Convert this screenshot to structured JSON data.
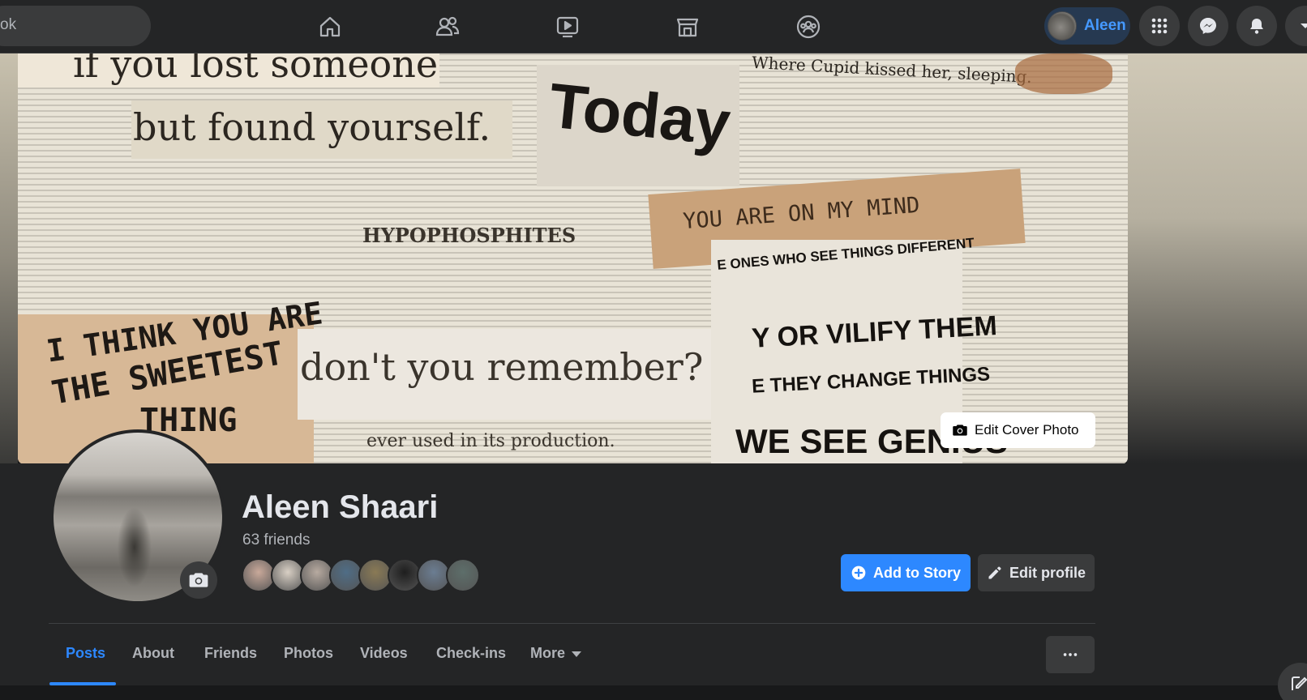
{
  "search": {
    "value": "ok"
  },
  "nav": [
    {
      "name": "home-icon"
    },
    {
      "name": "friends-icon"
    },
    {
      "name": "watch-icon"
    },
    {
      "name": "marketplace-icon"
    },
    {
      "name": "groups-icon"
    }
  ],
  "account": {
    "name": "Aleen"
  },
  "cover": {
    "clippings": [
      "if you lost someone",
      "but found yourself.",
      "Today",
      "YOU ARE ON MY MIND",
      "I THINK YOU ARE",
      "THE SWEETEST",
      "THING",
      "don't you remember?",
      "Y OR VILIFY THEM",
      "E THEY CHANGE THINGS",
      "WE SEE GENIUS",
      "ever used in its production.",
      "Where Cupid kissed her, sleeping.",
      "HYPOPHOSPHITES",
      "E ONES WHO SEE THINGS DIFFERENT"
    ],
    "edit_label": "Edit Cover Photo"
  },
  "profile": {
    "name": "Aleen Shaari",
    "friends_count": "63 friends",
    "friend_avatar_colors": [
      "#c9a99a",
      "#d8cfc4",
      "#b7aaa0",
      "#4f6d86",
      "#8a7a55",
      "#1e1e1e",
      "#6b7d92",
      "#5d6e6a"
    ]
  },
  "actions": {
    "add_story": "Add to Story",
    "edit_profile": "Edit profile"
  },
  "tabs": [
    {
      "label": "Posts",
      "active": true
    },
    {
      "label": "About"
    },
    {
      "label": "Friends"
    },
    {
      "label": "Photos"
    },
    {
      "label": "Videos"
    },
    {
      "label": "Check-ins"
    },
    {
      "label": "More"
    }
  ],
  "colors": {
    "accent": "#2d88ff",
    "surface": "#242526",
    "button": "#3a3b3c"
  }
}
